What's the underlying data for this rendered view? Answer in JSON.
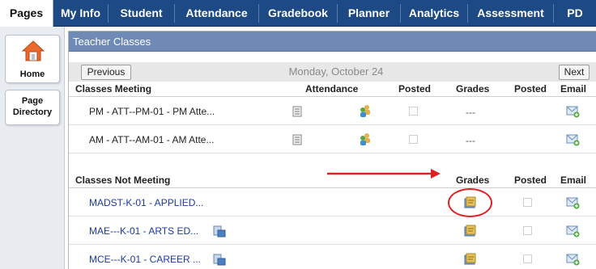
{
  "topnav": {
    "tabs": [
      {
        "label": "Pages",
        "active": true
      },
      {
        "label": "My Info"
      },
      {
        "label": "Student"
      },
      {
        "label": "Attendance"
      },
      {
        "label": "Gradebook"
      },
      {
        "label": "Planner"
      },
      {
        "label": "Analytics"
      },
      {
        "label": "Assessment"
      },
      {
        "label": "PD"
      }
    ]
  },
  "leftpanel": {
    "home_label": "Home",
    "directory_label": "Page Directory"
  },
  "panel": {
    "title": "Teacher Classes",
    "prev_label": "Previous",
    "date": "Monday, October 24",
    "next_label": "Next"
  },
  "meeting": {
    "heading": "Classes Meeting",
    "col_attendance": "Attendance",
    "col_posted": "Posted",
    "col_grades": "Grades",
    "col_posted2": "Posted",
    "col_email": "Email",
    "rows": [
      {
        "name": "PM - ATT--PM-01 - PM Atte...",
        "grades": "---"
      },
      {
        "name": "AM - ATT--AM-01 - AM Atte...",
        "grades": "---"
      }
    ]
  },
  "not_meeting": {
    "heading": "Classes Not Meeting",
    "col_grades": "Grades",
    "col_posted": "Posted",
    "col_email": "Email",
    "rows": [
      {
        "name": "MADST-K-01 - APPLIED..."
      },
      {
        "name": "MAE---K-01 - ARTS ED..."
      },
      {
        "name": "MCE---K-01 - CAREER ..."
      }
    ]
  },
  "colors": {
    "nav": "#1d4a85",
    "panel_header": "#6f8bb5",
    "link": "#1d3a9e",
    "annotation": "#e02020"
  }
}
